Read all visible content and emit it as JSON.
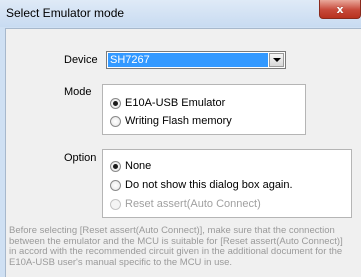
{
  "window": {
    "title": "Select Emulator mode",
    "close_glyph": "x"
  },
  "device": {
    "label": "Device",
    "value": "SH7267"
  },
  "mode": {
    "label": "Mode",
    "options": [
      {
        "label": "E10A-USB Emulator",
        "selected": true
      },
      {
        "label": "Writing Flash memory",
        "selected": false
      }
    ]
  },
  "option": {
    "label": "Option",
    "options": [
      {
        "label": "None",
        "selected": true,
        "enabled": true
      },
      {
        "label": "Do not show this dialog box again.",
        "selected": false,
        "enabled": true
      },
      {
        "label": "Reset assert(Auto Connect)",
        "selected": false,
        "enabled": false
      }
    ]
  },
  "note": {
    "lines": [
      "Before selecting [Reset assert(Auto Connect)], make sure that the connection",
      "between the emulator and the MCU is suitable for [Reset assert(Auto Connect)]",
      "in accord with the recommended circuit given in the additional document for the",
      "E10A-USB user's manual specific to the MCU in use."
    ]
  }
}
